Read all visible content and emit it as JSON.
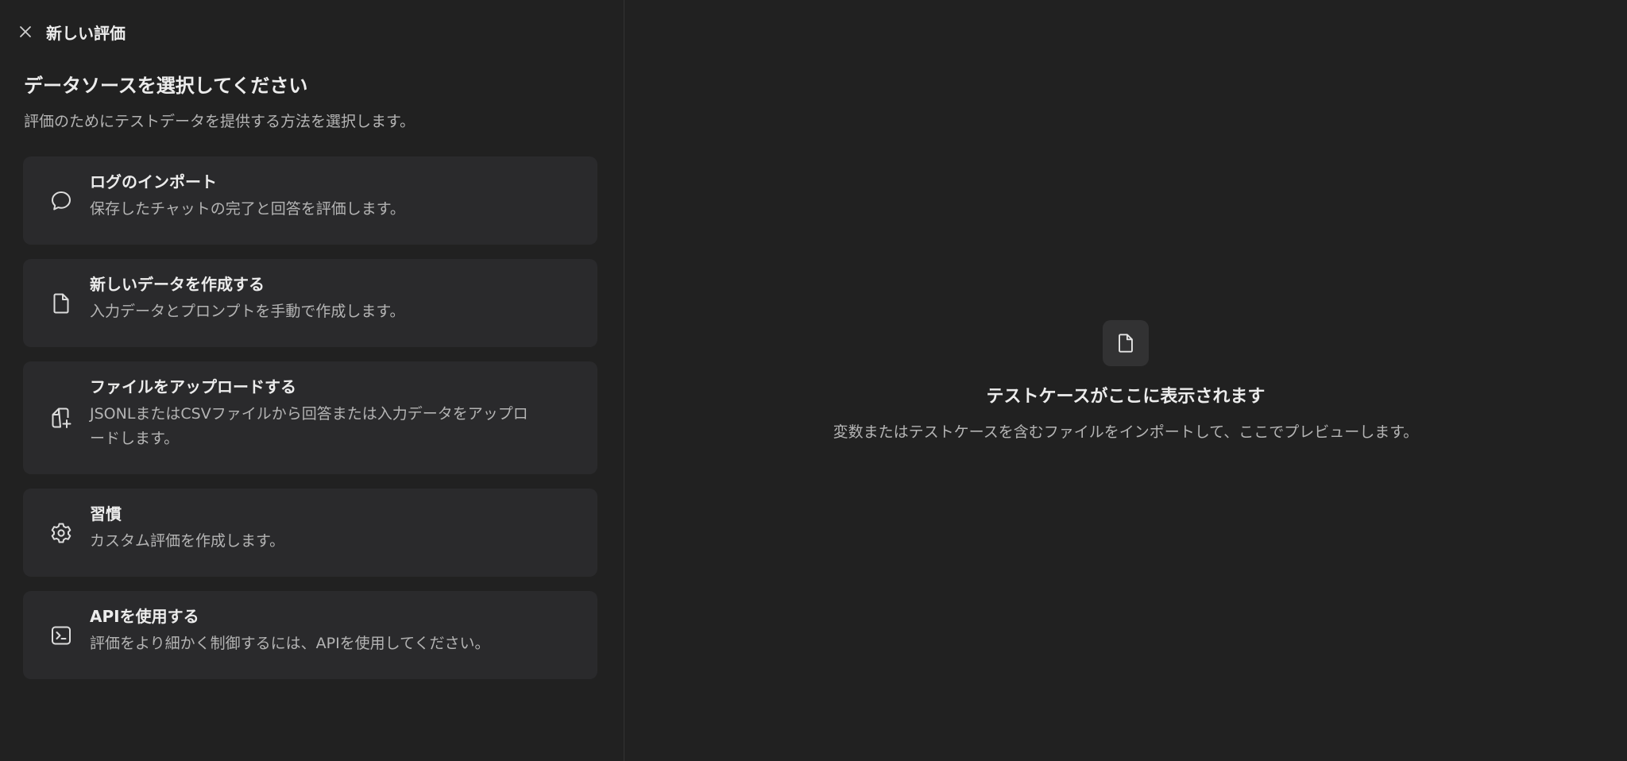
{
  "header": {
    "title": "新しい評価",
    "close_icon": "close-icon"
  },
  "data_source": {
    "heading": "データソースを選択してください",
    "subtitle": "評価のためにテストデータを提供する方法を選択します。",
    "options": [
      {
        "icon": "chat-bubble-icon",
        "title": "ログのインポート",
        "description": "保存したチャットの完了と回答を評価します。"
      },
      {
        "icon": "document-icon",
        "title": "新しいデータを作成する",
        "description": "入力データとプロンプトを手動で作成します。"
      },
      {
        "icon": "file-upload-icon",
        "title": "ファイルをアップロードする",
        "description": "JSONLまたはCSVファイルから回答または入力データをアップロードします。"
      },
      {
        "icon": "gear-icon",
        "title": "習慣",
        "description": "カスタム評価を作成します。"
      },
      {
        "icon": "terminal-icon",
        "title": "APIを使用する",
        "description": "評価をより細かく制御するには、APIを使用してください。"
      }
    ]
  },
  "preview": {
    "icon": "document-icon",
    "title": "テストケースがここに表示されます",
    "description": "変数またはテストケースを含むファイルをインポートして、ここでプレビューします。"
  },
  "colors": {
    "background": "#212121",
    "card": "#2a2a2c",
    "text_primary": "#ececec",
    "text_secondary": "#b4b4b4"
  }
}
